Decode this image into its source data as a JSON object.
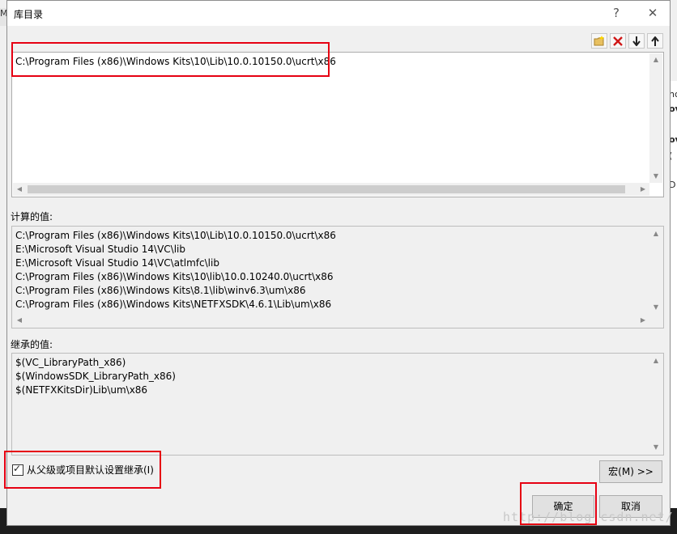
{
  "dialog": {
    "title": "库目录",
    "help_symbol": "?",
    "close_symbol": "✕"
  },
  "toolbar": {
    "new_line_icon": "new-folder-icon",
    "delete_icon": "delete-icon",
    "move_down_icon": "arrow-down-icon",
    "move_up_icon": "arrow-up-icon"
  },
  "editor": {
    "lines": [
      "C:\\Program Files (x86)\\Windows Kits\\10\\Lib\\10.0.10150.0\\ucrt\\x86"
    ]
  },
  "evaluated": {
    "label": "计算的值:",
    "lines": [
      "C:\\Program Files (x86)\\Windows Kits\\10\\Lib\\10.0.10150.0\\ucrt\\x86",
      "E:\\Microsoft Visual Studio 14\\VC\\lib",
      "E:\\Microsoft Visual Studio 14\\VC\\atlmfc\\lib",
      "C:\\Program Files (x86)\\Windows Kits\\10\\lib\\10.0.10240.0\\ucrt\\x86",
      "C:\\Program Files (x86)\\Windows Kits\\8.1\\lib\\winv6.3\\um\\x86",
      "C:\\Program Files (x86)\\Windows Kits\\NETFXSDK\\4.6.1\\Lib\\um\\x86"
    ]
  },
  "inherited": {
    "label": "继承的值:",
    "lines": [
      "$(VC_LibraryPath_x86)",
      "$(WindowsSDK_LibraryPath_x86)",
      "$(NETFXKitsDir)Lib\\um\\x86"
    ]
  },
  "inherit_checkbox": {
    "label": "从父级或项目默认设置继承(I)",
    "checked": true
  },
  "buttons": {
    "macro": "宏(M) >>",
    "ok": "确定",
    "cancel": "取消"
  },
  "background": {
    "right_fragments": [
      "nc",
      "ov",
      "ov",
      "(",
      "D"
    ],
    "left_fragment": "M"
  },
  "watermark": "http://blog.csdn.net/"
}
